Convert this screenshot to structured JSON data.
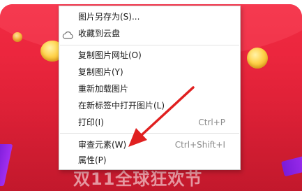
{
  "background": {
    "slogan": "双11全球狂欢节",
    "accent_color": "#e72239"
  },
  "context_menu": {
    "items": [
      {
        "label": "图片另存为(S)...",
        "shortcut": ""
      },
      {
        "label": "收藏到云盘",
        "shortcut": "",
        "icon": "cloud-icon"
      },
      {
        "label": "复制图片网址(O)",
        "shortcut": ""
      },
      {
        "label": "复制图片(Y)",
        "shortcut": ""
      },
      {
        "label": "重新加载图片",
        "shortcut": ""
      },
      {
        "label": "在新标签中打开图片(L)",
        "shortcut": ""
      },
      {
        "label": "打印(I)",
        "shortcut": "Ctrl+P"
      },
      {
        "label": "审查元素(W)",
        "shortcut": "Ctrl+Shift+I"
      },
      {
        "label": "属性(P)",
        "shortcut": ""
      }
    ]
  },
  "annotation": {
    "arrow_color": "#e02020",
    "points_to": "审查元素(W)"
  }
}
